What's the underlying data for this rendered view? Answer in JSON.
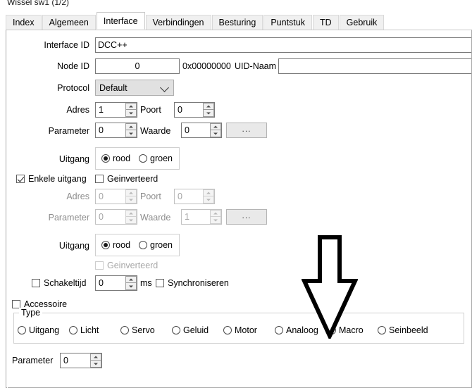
{
  "window": {
    "title": "Wissel sw1 (1/2)"
  },
  "tabs": [
    {
      "label": "Index",
      "active": false
    },
    {
      "label": "Algemeen",
      "active": false
    },
    {
      "label": "Interface",
      "active": true
    },
    {
      "label": "Verbindingen",
      "active": false
    },
    {
      "label": "Besturing",
      "active": false
    },
    {
      "label": "Puntstuk",
      "active": false
    },
    {
      "label": "TD",
      "active": false
    },
    {
      "label": "Gebruik",
      "active": false
    }
  ],
  "interface": {
    "interface_id_label": "Interface ID",
    "interface_id_value": "DCC++",
    "node_id_label": "Node ID",
    "node_id_value": "0",
    "node_id_hex": "0x00000000",
    "uid_name_label": "UID-Naam",
    "uid_name_value": "",
    "protocol_label": "Protocol",
    "protocol_value": "Default"
  },
  "primary": {
    "adres_label": "Adres",
    "adres_value": "1",
    "poort_label": "Poort",
    "poort_value": "0",
    "parameter_label": "Parameter",
    "parameter_value": "0",
    "waarde_label": "Waarde",
    "waarde_value": "0",
    "dots_label": "...",
    "uitgang_label": "Uitgang",
    "rood_label": "rood",
    "groen_label": "groen",
    "rood_selected": true,
    "enkele_uitgang_label": "Enkele uitgang",
    "enkele_uitgang_checked": true,
    "geinverteerd_label": "Geinverteerd",
    "geinverteerd_checked": false
  },
  "secondary": {
    "adres_label": "Adres",
    "adres_value": "0",
    "poort_label": "Poort",
    "poort_value": "0",
    "parameter_label": "Parameter",
    "parameter_value": "0",
    "waarde_label": "Waarde",
    "waarde_value": "1",
    "dots_label": "...",
    "uitgang_label": "Uitgang",
    "rood_label": "rood",
    "groen_label": "groen",
    "rood_selected": true,
    "geinverteerd_label": "Geinverteerd",
    "geinverteerd_checked": false,
    "schakeltijd_label": "Schakeltijd",
    "schakeltijd_checked": false,
    "schakeltijd_value": "0",
    "ms_label": "ms",
    "synchroniseren_label": "Synchroniseren",
    "synchroniseren_checked": false
  },
  "accessory": {
    "accessoire_label": "Accessoire",
    "accessoire_checked": false,
    "type_legend": "Type",
    "types": [
      {
        "label": "Uitgang",
        "selected": false
      },
      {
        "label": "Licht",
        "selected": false
      },
      {
        "label": "Servo",
        "selected": false
      },
      {
        "label": "Geluid",
        "selected": false
      },
      {
        "label": "Motor",
        "selected": false
      },
      {
        "label": "Analoog",
        "selected": false
      },
      {
        "label": "Macro",
        "selected": true
      },
      {
        "label": "Seinbeeld",
        "selected": false
      }
    ],
    "parameter_label": "Parameter",
    "parameter_value": "0"
  },
  "annotation": {
    "arrow": "down-arrow-annotation"
  }
}
